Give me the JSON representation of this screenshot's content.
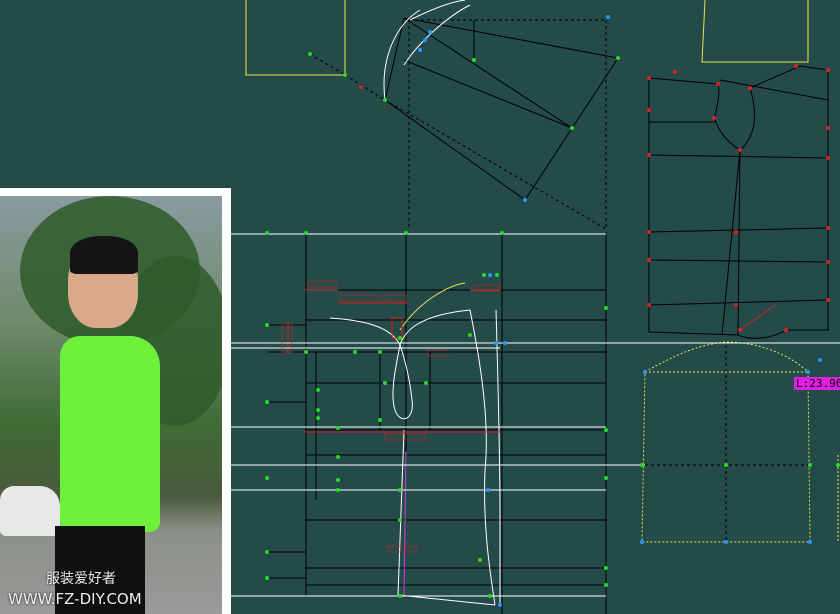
{
  "watermark": {
    "chinese_text": "服装爱好者",
    "url_text": "WWW.FZ-DIY.COM"
  },
  "measure": {
    "length_readout": "L:23.96"
  },
  "colors": {
    "background": "#254a4a",
    "pattern_line": "#000000",
    "curve_line": "#ffffff",
    "reference_line": "#ffffff",
    "dimension": "#d42020",
    "control_point": "#22dd22",
    "endpoint": "#2299ff",
    "corner_point": "#dd2222",
    "dashed_piece": "#e6e64a",
    "magenta_line": "#d43cd4",
    "readout_bg": "#e020e0"
  },
  "icons": [
    "photo-reference",
    "pattern-piece",
    "measure-readout"
  ]
}
